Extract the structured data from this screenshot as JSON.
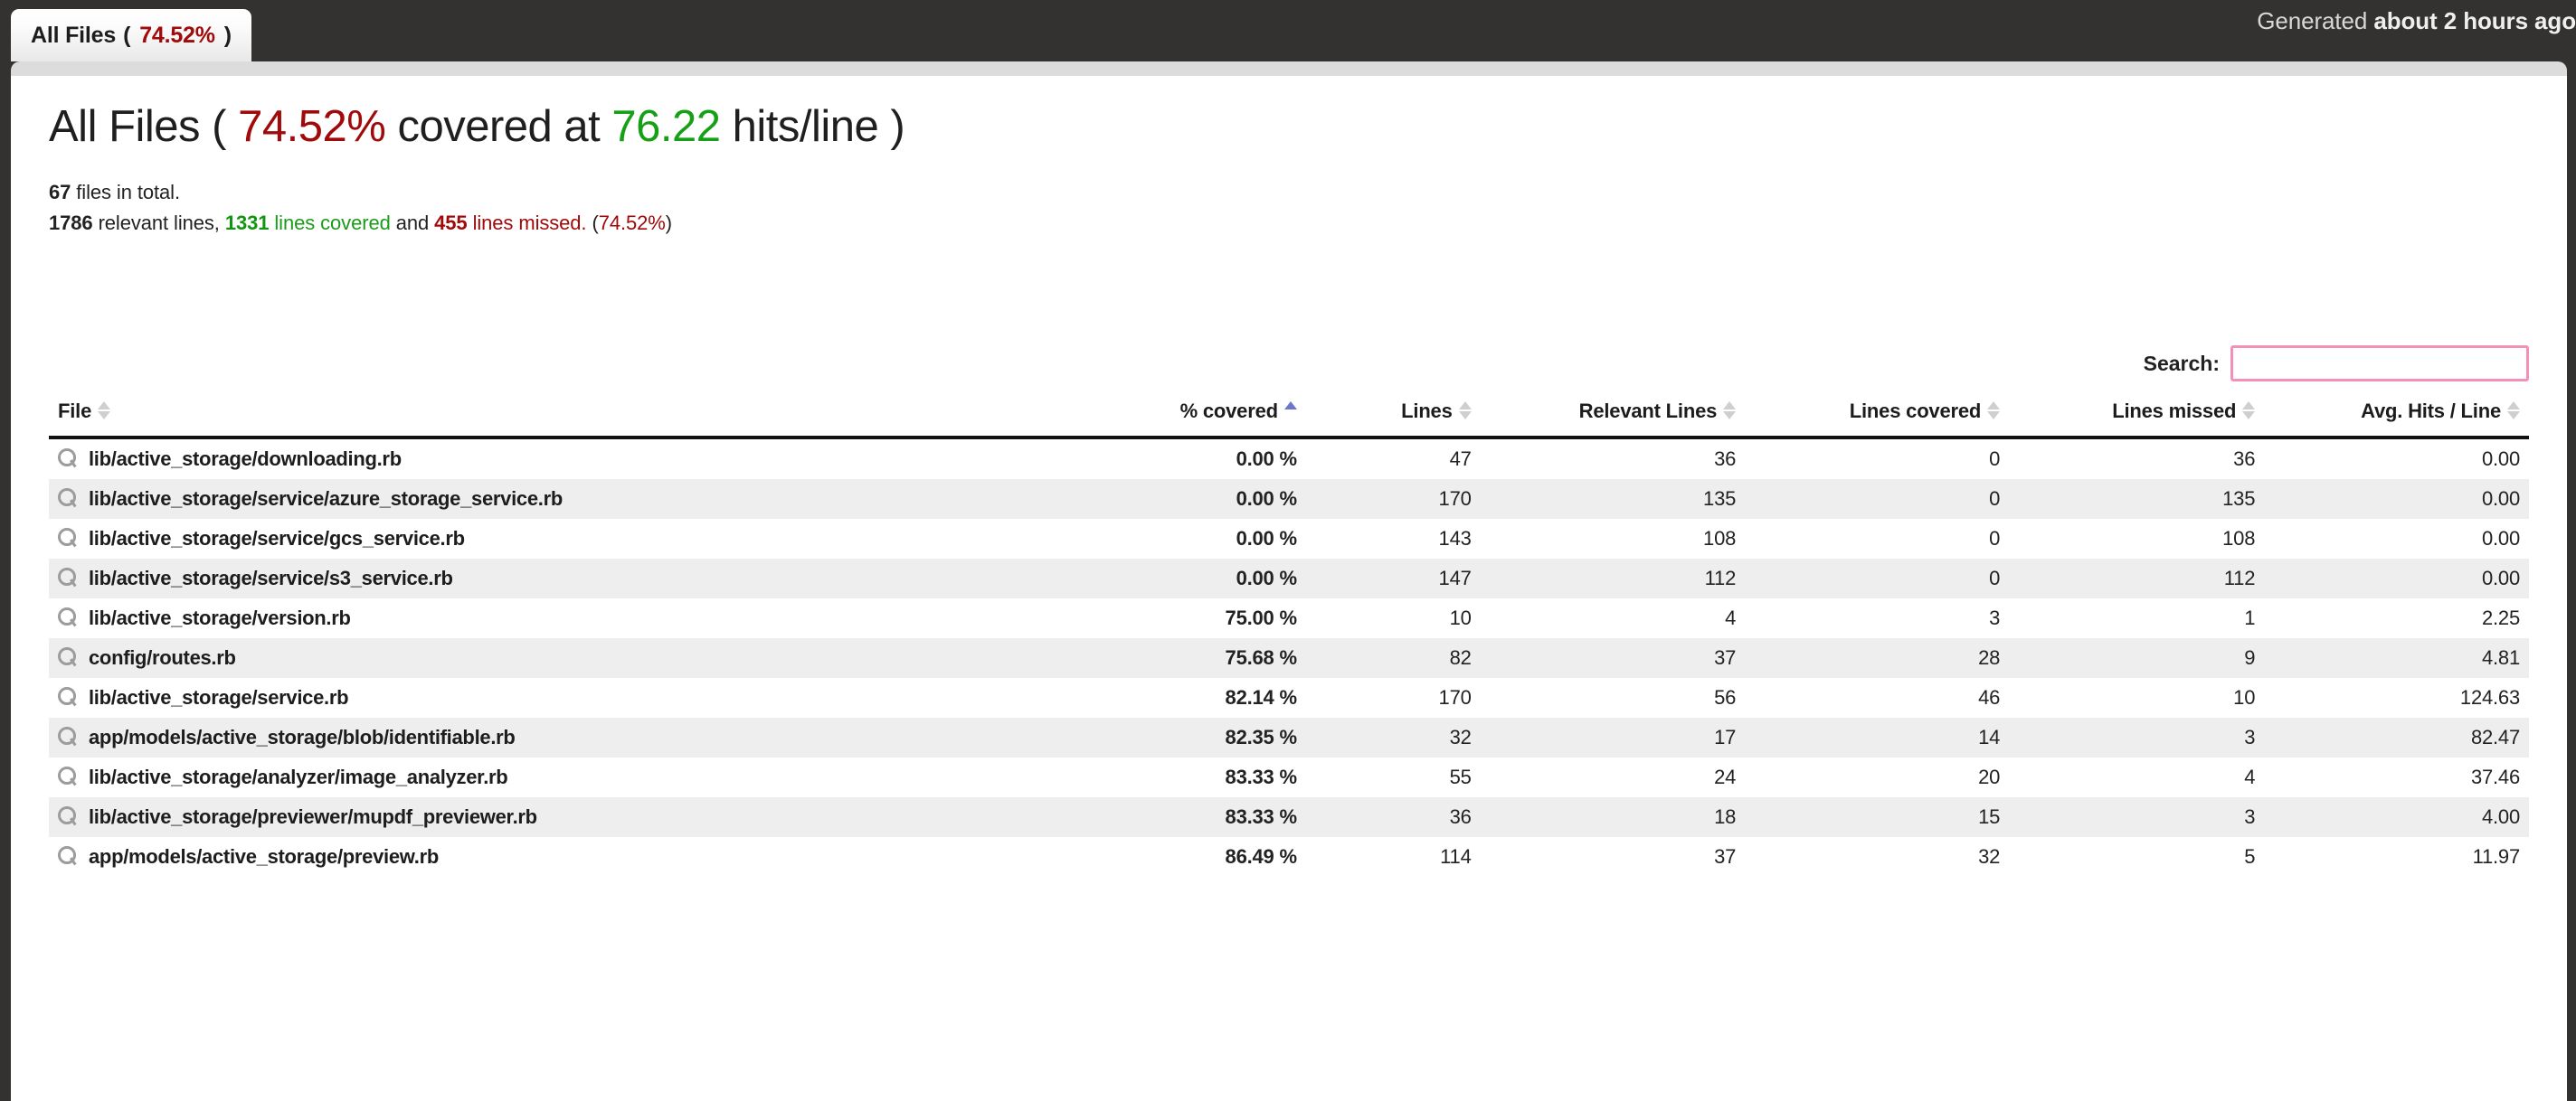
{
  "tab": {
    "label_prefix": "All Files",
    "open_paren": "(",
    "percent": "74.52%",
    "close_paren": ")"
  },
  "header": {
    "generated_prefix": "Generated",
    "generated_value": "about 2 hours ago"
  },
  "title": {
    "name": "All Files",
    "open_paren": "(",
    "percent": "74.52%",
    "covered_at": "covered at",
    "hits": "76.22",
    "hits_unit": "hits/line",
    "close_paren": ")"
  },
  "summary": {
    "files_count": "67",
    "files_suffix": "files in total.",
    "relevant_lines": "1786",
    "relevant_suffix": "relevant lines,",
    "lines_covered": "1331",
    "covered_suffix": "lines covered",
    "and": "and",
    "lines_missed": "455",
    "missed_suffix": "lines missed.",
    "open_paren": "(",
    "total_percent": "74.52%",
    "close_paren": ")"
  },
  "search": {
    "label": "Search:",
    "value": "",
    "placeholder": ""
  },
  "table": {
    "columns": [
      {
        "label": "File",
        "sort": "none"
      },
      {
        "label": "% covered",
        "sort": "asc"
      },
      {
        "label": "Lines",
        "sort": "none"
      },
      {
        "label": "Relevant Lines",
        "sort": "none"
      },
      {
        "label": "Lines covered",
        "sort": "none"
      },
      {
        "label": "Lines missed",
        "sort": "none"
      },
      {
        "label": "Avg. Hits / Line",
        "sort": "none"
      }
    ],
    "rows": [
      {
        "file": "lib/active_storage/downloading.rb",
        "pct": "0.00 %",
        "pct_class": "pct-low",
        "lines": "47",
        "relevant": "36",
        "covered": "0",
        "missed": "36",
        "avg": "0.00"
      },
      {
        "file": "lib/active_storage/service/azure_storage_service.rb",
        "pct": "0.00 %",
        "pct_class": "pct-low",
        "lines": "170",
        "relevant": "135",
        "covered": "0",
        "missed": "135",
        "avg": "0.00"
      },
      {
        "file": "lib/active_storage/service/gcs_service.rb",
        "pct": "0.00 %",
        "pct_class": "pct-low",
        "lines": "143",
        "relevant": "108",
        "covered": "0",
        "missed": "108",
        "avg": "0.00"
      },
      {
        "file": "lib/active_storage/service/s3_service.rb",
        "pct": "0.00 %",
        "pct_class": "pct-low",
        "lines": "147",
        "relevant": "112",
        "covered": "0",
        "missed": "112",
        "avg": "0.00"
      },
      {
        "file": "lib/active_storage/version.rb",
        "pct": "75.00 %",
        "pct_class": "pct-low",
        "lines": "10",
        "relevant": "4",
        "covered": "3",
        "missed": "1",
        "avg": "2.25"
      },
      {
        "file": "config/routes.rb",
        "pct": "75.68 %",
        "pct_class": "pct-low",
        "lines": "82",
        "relevant": "37",
        "covered": "28",
        "missed": "9",
        "avg": "4.81"
      },
      {
        "file": "lib/active_storage/service.rb",
        "pct": "82.14 %",
        "pct_class": "pct-medium",
        "lines": "170",
        "relevant": "56",
        "covered": "46",
        "missed": "10",
        "avg": "124.63"
      },
      {
        "file": "app/models/active_storage/blob/identifiable.rb",
        "pct": "82.35 %",
        "pct_class": "pct-medium",
        "lines": "32",
        "relevant": "17",
        "covered": "14",
        "missed": "3",
        "avg": "82.47"
      },
      {
        "file": "lib/active_storage/analyzer/image_analyzer.rb",
        "pct": "83.33 %",
        "pct_class": "pct-medium",
        "lines": "55",
        "relevant": "24",
        "covered": "20",
        "missed": "4",
        "avg": "37.46"
      },
      {
        "file": "lib/active_storage/previewer/mupdf_previewer.rb",
        "pct": "83.33 %",
        "pct_class": "pct-medium",
        "lines": "36",
        "relevant": "18",
        "covered": "15",
        "missed": "3",
        "avg": "4.00"
      },
      {
        "file": "app/models/active_storage/preview.rb",
        "pct": "86.49 %",
        "pct_class": "pct-medium",
        "lines": "114",
        "relevant": "37",
        "covered": "32",
        "missed": "5",
        "avg": "11.97"
      }
    ]
  },
  "colors": {
    "accent_red": "#a00a0a",
    "accent_green": "#16a016",
    "accent_amber": "#e0a30f",
    "sort_blue": "#6e76c8",
    "search_border": "#f490b8",
    "chrome_dark": "#333231"
  }
}
